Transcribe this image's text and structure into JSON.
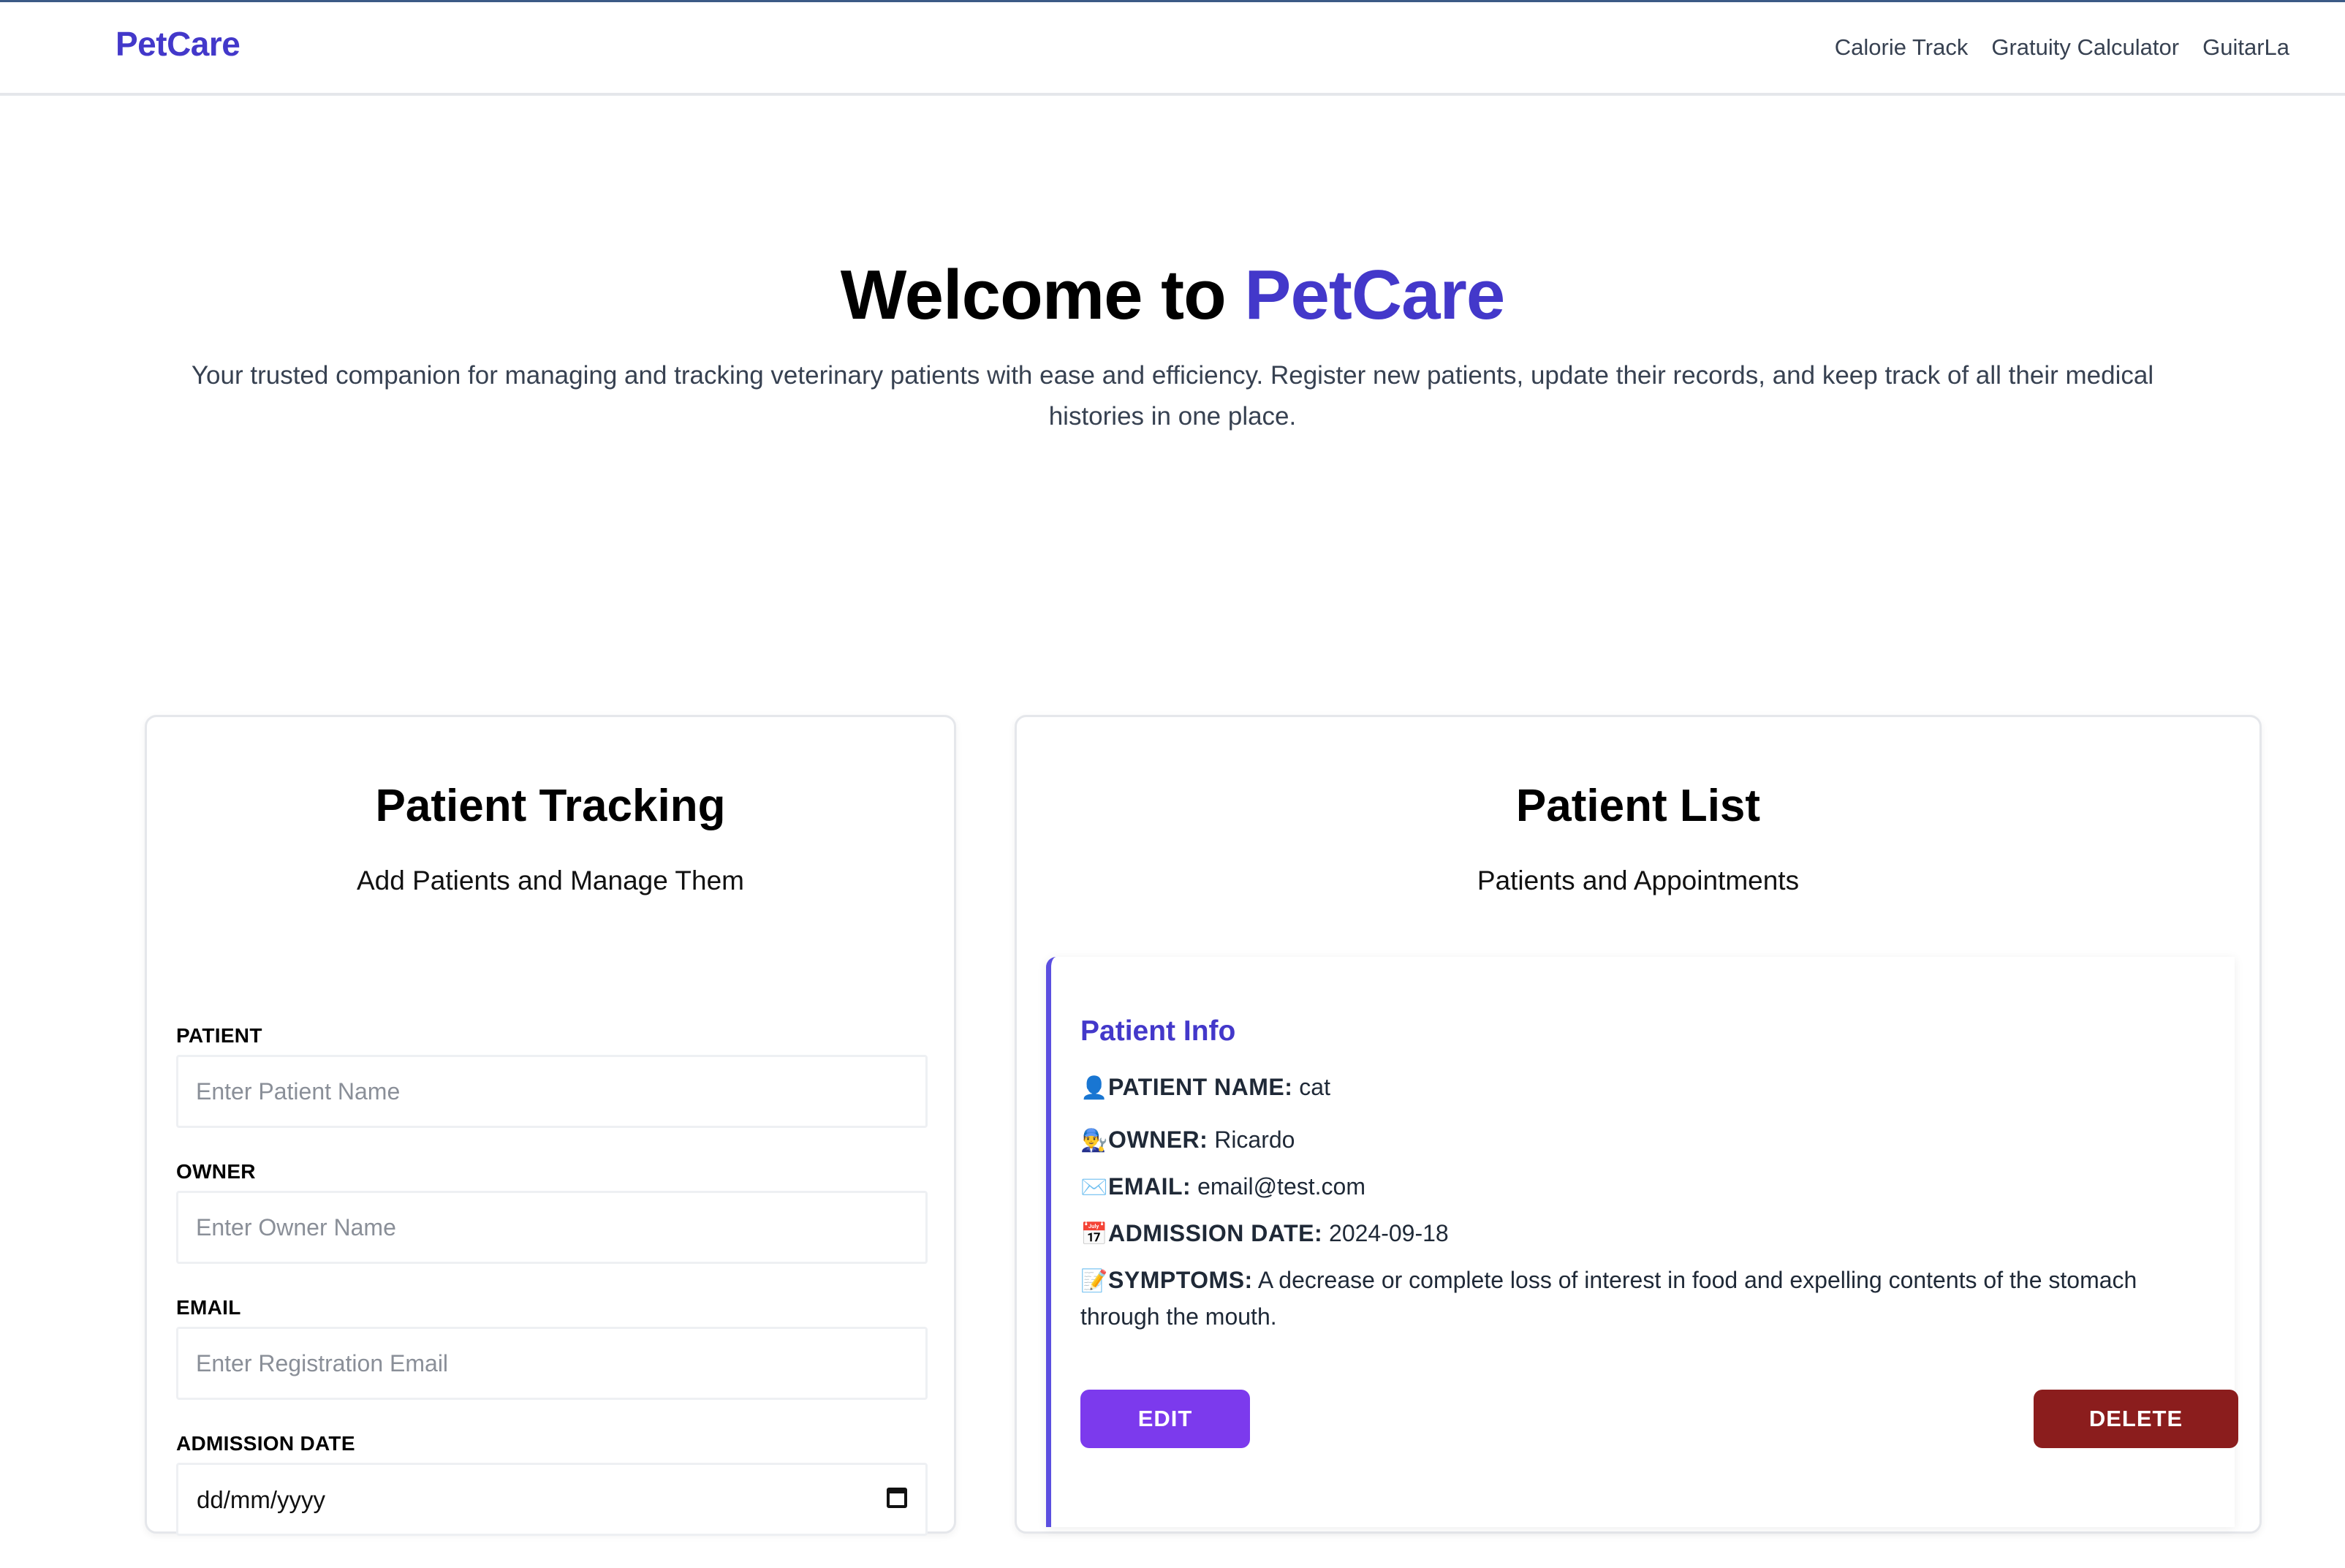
{
  "header": {
    "logo": "PetCare",
    "nav": [
      "Calorie Track",
      "Gratuity Calculator",
      "GuitarLa"
    ]
  },
  "hero": {
    "title_prefix": "Welcome to",
    "title_brand": "PetCare",
    "description": "Your trusted companion for managing and tracking veterinary patients with ease and efficiency. Register new patients, update their records, and keep track of all their medical histories in one place."
  },
  "tracking": {
    "title": "Patient Tracking",
    "subtitle": "Add Patients and Manage Them",
    "fields": {
      "patient": {
        "label": "PATIENT",
        "placeholder": "Enter Patient Name"
      },
      "owner": {
        "label": "OWNER",
        "placeholder": "Enter Owner Name"
      },
      "email": {
        "label": "EMAIL",
        "placeholder": "Enter Registration Email"
      },
      "date": {
        "label": "ADMISSION DATE",
        "placeholder": "dd/mm/yyyy"
      }
    }
  },
  "list": {
    "title": "Patient List",
    "subtitle": "Patients and Appointments",
    "card": {
      "heading": "Patient Info",
      "name_label": "PATIENT NAME:",
      "name_value": "cat",
      "owner_label": "OWNER:",
      "owner_value": "Ricardo",
      "email_label": "EMAIL:",
      "email_value": "email@test.com",
      "date_label": "ADMISSION DATE:",
      "date_value": "2024-09-18",
      "symptoms_label": "SYMPTOMS:",
      "symptoms_value": "A decrease or complete loss of interest in food and expelling contents of the stomach through the mouth.",
      "icons": {
        "name": "👤",
        "owner": "👨‍🔧",
        "email": "✉️",
        "date": "📅",
        "symptoms": "📝"
      },
      "edit_label": "EDIT",
      "delete_label": "DELETE"
    }
  },
  "colors": {
    "brand": "#4338ca",
    "edit": "#7c3aed",
    "delete": "#8b1d1d"
  }
}
